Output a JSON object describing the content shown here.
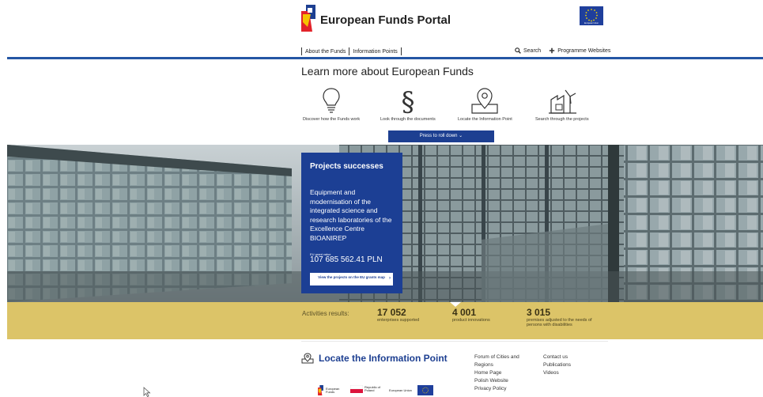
{
  "header": {
    "brand": "European Funds Portal",
    "eu_flag_caption": "European Union",
    "nav": [
      "About the Funds",
      "Information Points"
    ],
    "search_label": "Search",
    "programme_label": "Programme Websites"
  },
  "learn": {
    "title": "Learn more about European Funds",
    "tiles": [
      {
        "icon": "lightbulb-icon",
        "label": "Discover how the Funds work"
      },
      {
        "icon": "section-sign-icon",
        "label": "Look through the documents"
      },
      {
        "icon": "map-pin-icon",
        "label": "Locate the Information Point"
      },
      {
        "icon": "factory-icon",
        "label": "Search through the projects"
      }
    ],
    "roll_button": "Press to roll down"
  },
  "hero": {
    "card_title": "Projects successes",
    "card_description": "Equipment and modernisation of the integrated science and research laboratories of the Excellence Centre BIOANIREP",
    "grant_label": "EU grant value",
    "grant_value": "107 685 562.41 PLN",
    "map_button": "View the projects on the EU grants map"
  },
  "results": {
    "label": "Activities results:",
    "items": [
      {
        "value": "17 052",
        "text": "enterprises supported"
      },
      {
        "value": "4 001",
        "text": "product innovations"
      },
      {
        "value": "3 015",
        "text": "premises adjusted to the needs of persons with disabilities"
      }
    ]
  },
  "footer": {
    "locate_title": "Locate the Information Point",
    "links_col1": [
      "Forum of Cities and",
      "Regions",
      "Home Page",
      "Polish Website",
      "Privacy Policy"
    ],
    "links_col2": [
      "Contact us",
      "Publications",
      "Videos"
    ],
    "logos": [
      "European Funds",
      "Republic of Poland",
      "European Union"
    ]
  },
  "colors": {
    "brand_blue": "#1d3f91",
    "header_line": "#2456a4",
    "results_band": "#dcc468"
  }
}
